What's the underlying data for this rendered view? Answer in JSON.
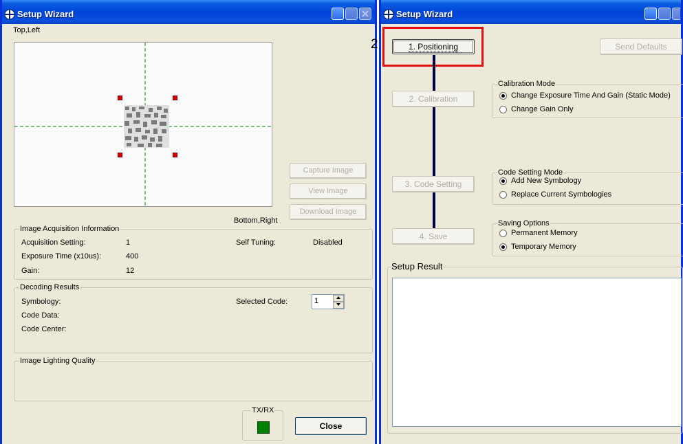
{
  "left_window": {
    "title": "Setup Wizard",
    "corner_top_left": "Top,Left",
    "corner_bottom_right": "Bottom,Right",
    "buttons": {
      "capture": "Capture Image",
      "view": "View Image",
      "download": "Download Image",
      "close": "Close"
    },
    "acquisition": {
      "title": "Image Acquisition Information",
      "setting_label": "Acquisition Setting:",
      "setting_value": "1",
      "exposure_label": "Exposure Time (x10us):",
      "exposure_value": "400",
      "gain_label": "Gain:",
      "gain_value": "12",
      "self_tuning_label": "Self Tuning:",
      "self_tuning_value": "Disabled"
    },
    "decoding": {
      "title": "Decoding Results",
      "symbology_label": "Symbology:",
      "code_data_label": "Code Data:",
      "code_center_label": "Code Center:",
      "selected_code_label": "Selected Code:",
      "selected_code_value": "1"
    },
    "lighting": {
      "title": "Image Lighting Quality"
    },
    "txrx": {
      "title": "TX/RX",
      "indicator_color": "#008000"
    }
  },
  "right_window": {
    "title": "Setup Wizard",
    "step_annotation": "2",
    "highlight_color": "#e01010",
    "send_defaults": "Send Defaults",
    "steps": {
      "positioning": "1. Positioning",
      "calibration": "2. Calibration",
      "code_setting": "3. Code Setting",
      "save": "4. Save"
    },
    "calibration_mode": {
      "title": "Calibration Mode",
      "option_exposure": "Change Exposure Time And Gain (Static Mode)",
      "option_gain": "Change Gain Only",
      "selected": "exposure"
    },
    "code_setting_mode": {
      "title": "Code Setting Mode",
      "option_add": "Add New Symbology",
      "option_replace": "Replace Current Symbologies",
      "selected": "add"
    },
    "saving_options": {
      "title": "Saving Options",
      "option_permanent": "Permanent Memory",
      "option_temporary": "Temporary Memory",
      "selected": "temporary"
    },
    "setup_result": {
      "title": "Setup Result"
    }
  }
}
